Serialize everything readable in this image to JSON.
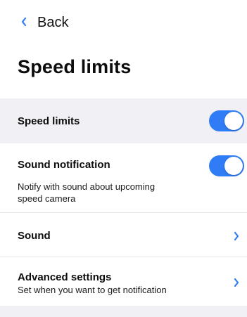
{
  "header": {
    "back_label": "Back",
    "title": "Speed limits"
  },
  "rows": {
    "speed_limits": {
      "title": "Speed limits",
      "toggle_on": true
    },
    "sound_notification": {
      "title": "Sound notification",
      "subtitle_line1": "Notify with sound about upcoming",
      "subtitle_line2": "speed camera",
      "toggle_on": true
    },
    "sound": {
      "title": "Sound"
    },
    "advanced_settings": {
      "title": "Advanced settings",
      "subtitle": "Set when you want to get notification"
    }
  },
  "colors": {
    "accent": "#2f7cf6",
    "section_bg": "#f0f0f5",
    "divider": "#e6e6ea"
  },
  "icons": {
    "back": "chevron-left-icon",
    "navigate": "chevron-right-icon"
  }
}
